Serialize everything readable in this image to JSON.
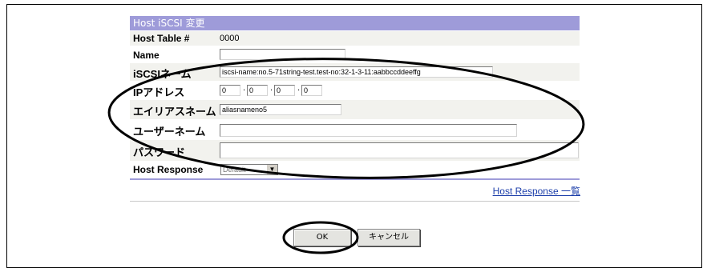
{
  "title": "Host iSCSI 変更",
  "fields": {
    "host_table_label": "Host Table #",
    "host_table_value": "0000",
    "name_label": "Name",
    "name_value": "",
    "iscsi_label": "iSCSIネーム",
    "iscsi_value": "iscsi-name:no.5-71string-test.test-no:32-1-3-11:aabbccddeeffg",
    "ip_label": "IPアドレス",
    "ip_octets": [
      "0",
      "0",
      "0",
      "0"
    ],
    "ip_separator": ".",
    "alias_label": "エイリアスネーム",
    "alias_value": "aliasnameno5",
    "user_label": "ユーザーネーム",
    "user_value": "",
    "password_label": "パスワード",
    "password_value": "",
    "host_response_label": "Host Response",
    "host_response_value": "Default"
  },
  "link_host_response_list": "Host Response 一覧",
  "buttons": {
    "ok": "OK",
    "cancel": "キャンセル"
  },
  "colors": {
    "title_bar": "#9e9bd9",
    "link": "#1d3faa"
  }
}
